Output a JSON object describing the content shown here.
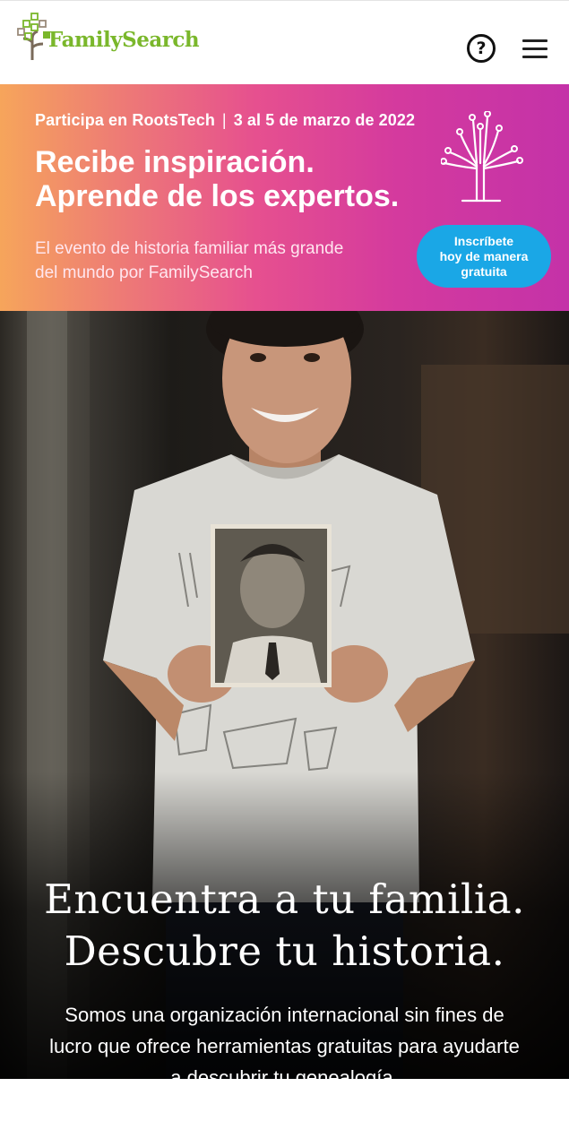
{
  "header": {
    "logo_text": "FamilySearch",
    "help_icon": "question-circle-icon",
    "help_label": "?",
    "menu_icon": "hamburger-menu-icon"
  },
  "banner": {
    "eyebrow_event": "Participa en RootsTech",
    "eyebrow_separator": "|",
    "eyebrow_dates": "3 al 5 de marzo de 2022",
    "title_line1": "Recibe inspiración.",
    "title_line2": "Aprende de los expertos.",
    "subtitle_line1": "El evento de historia familiar más grande",
    "subtitle_line2": "del mundo por FamilySearch",
    "cta_line1": "Inscríbete",
    "cta_line2": "hoy de manera",
    "cta_line3": "gratuita",
    "tree_icon": "rootstech-tree-icon",
    "colors": {
      "gradient_start": "#f6a55b",
      "gradient_end": "#c432a8",
      "cta": "#1aa7e6"
    }
  },
  "hero": {
    "image": "boy-holding-old-photo",
    "title_line1": "Encuentra a tu familia.",
    "title_line2": "Descubre tu historia.",
    "body_line1": "Somos una organización internacional sin fines de",
    "body_line2": "lucro que ofrece herramientas gratuitas para ayudarte",
    "body_line3": "a descubrir tu genealogía."
  },
  "colors": {
    "brand_green": "#7ab72b"
  }
}
